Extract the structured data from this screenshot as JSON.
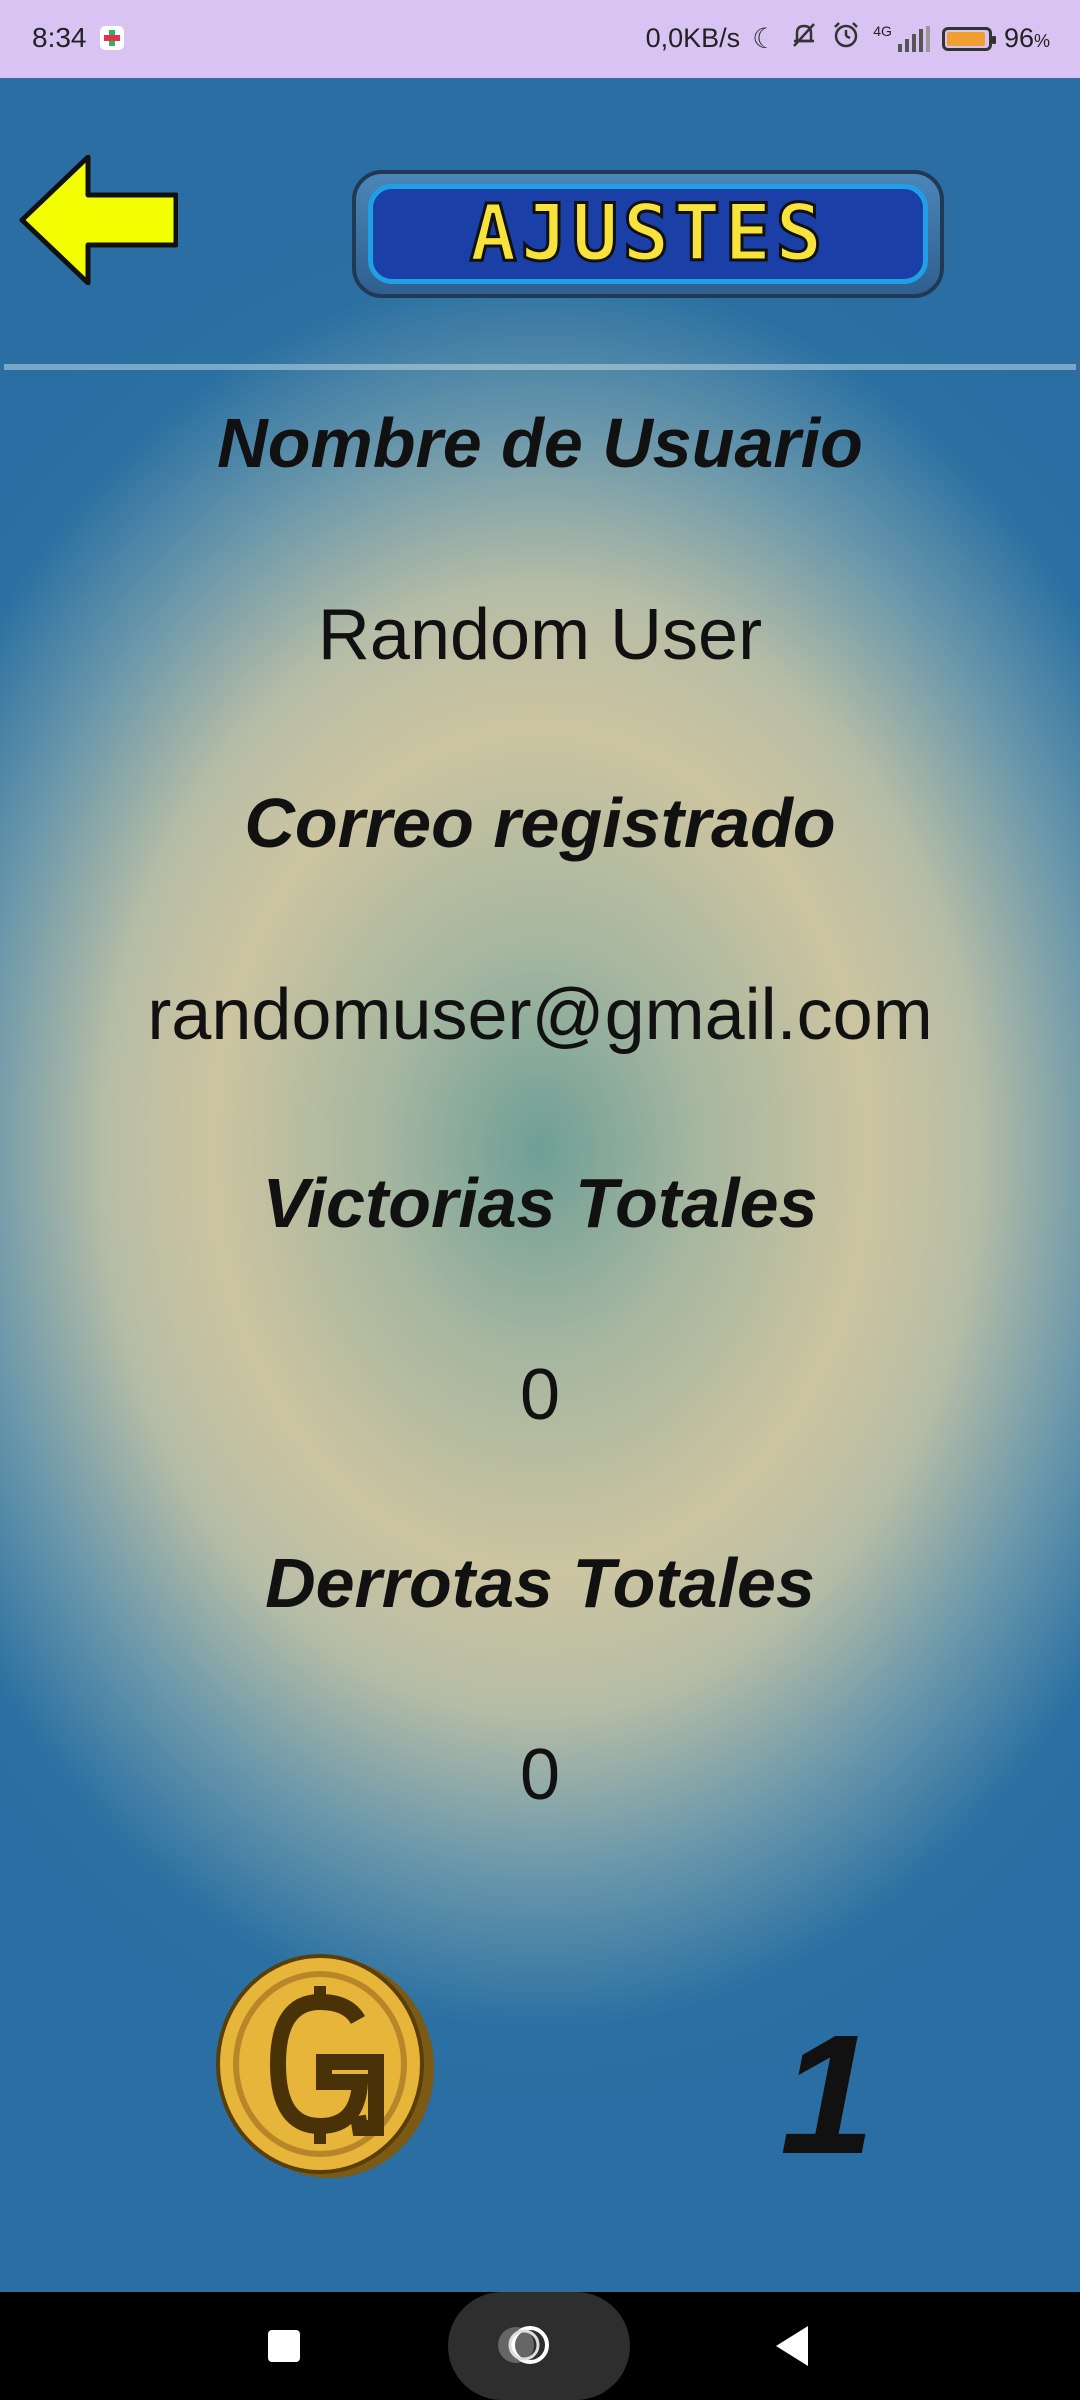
{
  "status_bar": {
    "time": "8:34",
    "speed": "0,0KB/s",
    "network": "4G",
    "battery_percent": "96",
    "battery_suffix": "%",
    "battery_level": 0.96,
    "icons": [
      "moon-icon",
      "muted-bell-icon",
      "alarm-icon",
      "signal-icon",
      "battery-icon"
    ]
  },
  "header": {
    "title": "AJUSTES",
    "back_icon": "arrow-left-icon"
  },
  "profile": {
    "username_label": "Nombre de Usuario",
    "username_value": "Random User",
    "email_label": "Correo registrado",
    "email_value": "randomuser@gmail.com",
    "wins_label": "Victorias Totales",
    "wins_value": "0",
    "losses_label": "Derrotas Totales",
    "losses_value": "0"
  },
  "coins": {
    "icon": "coin-icon",
    "count": "1"
  },
  "nav_bar": {
    "items": [
      "recent-apps",
      "home",
      "back"
    ]
  },
  "colors": {
    "status_bar_bg": "#d8c3f2",
    "arrow": "#f3ff00",
    "title_text": "#f7e33b",
    "coin": "#e6b53a",
    "background_edge": "#2a6ea3"
  }
}
